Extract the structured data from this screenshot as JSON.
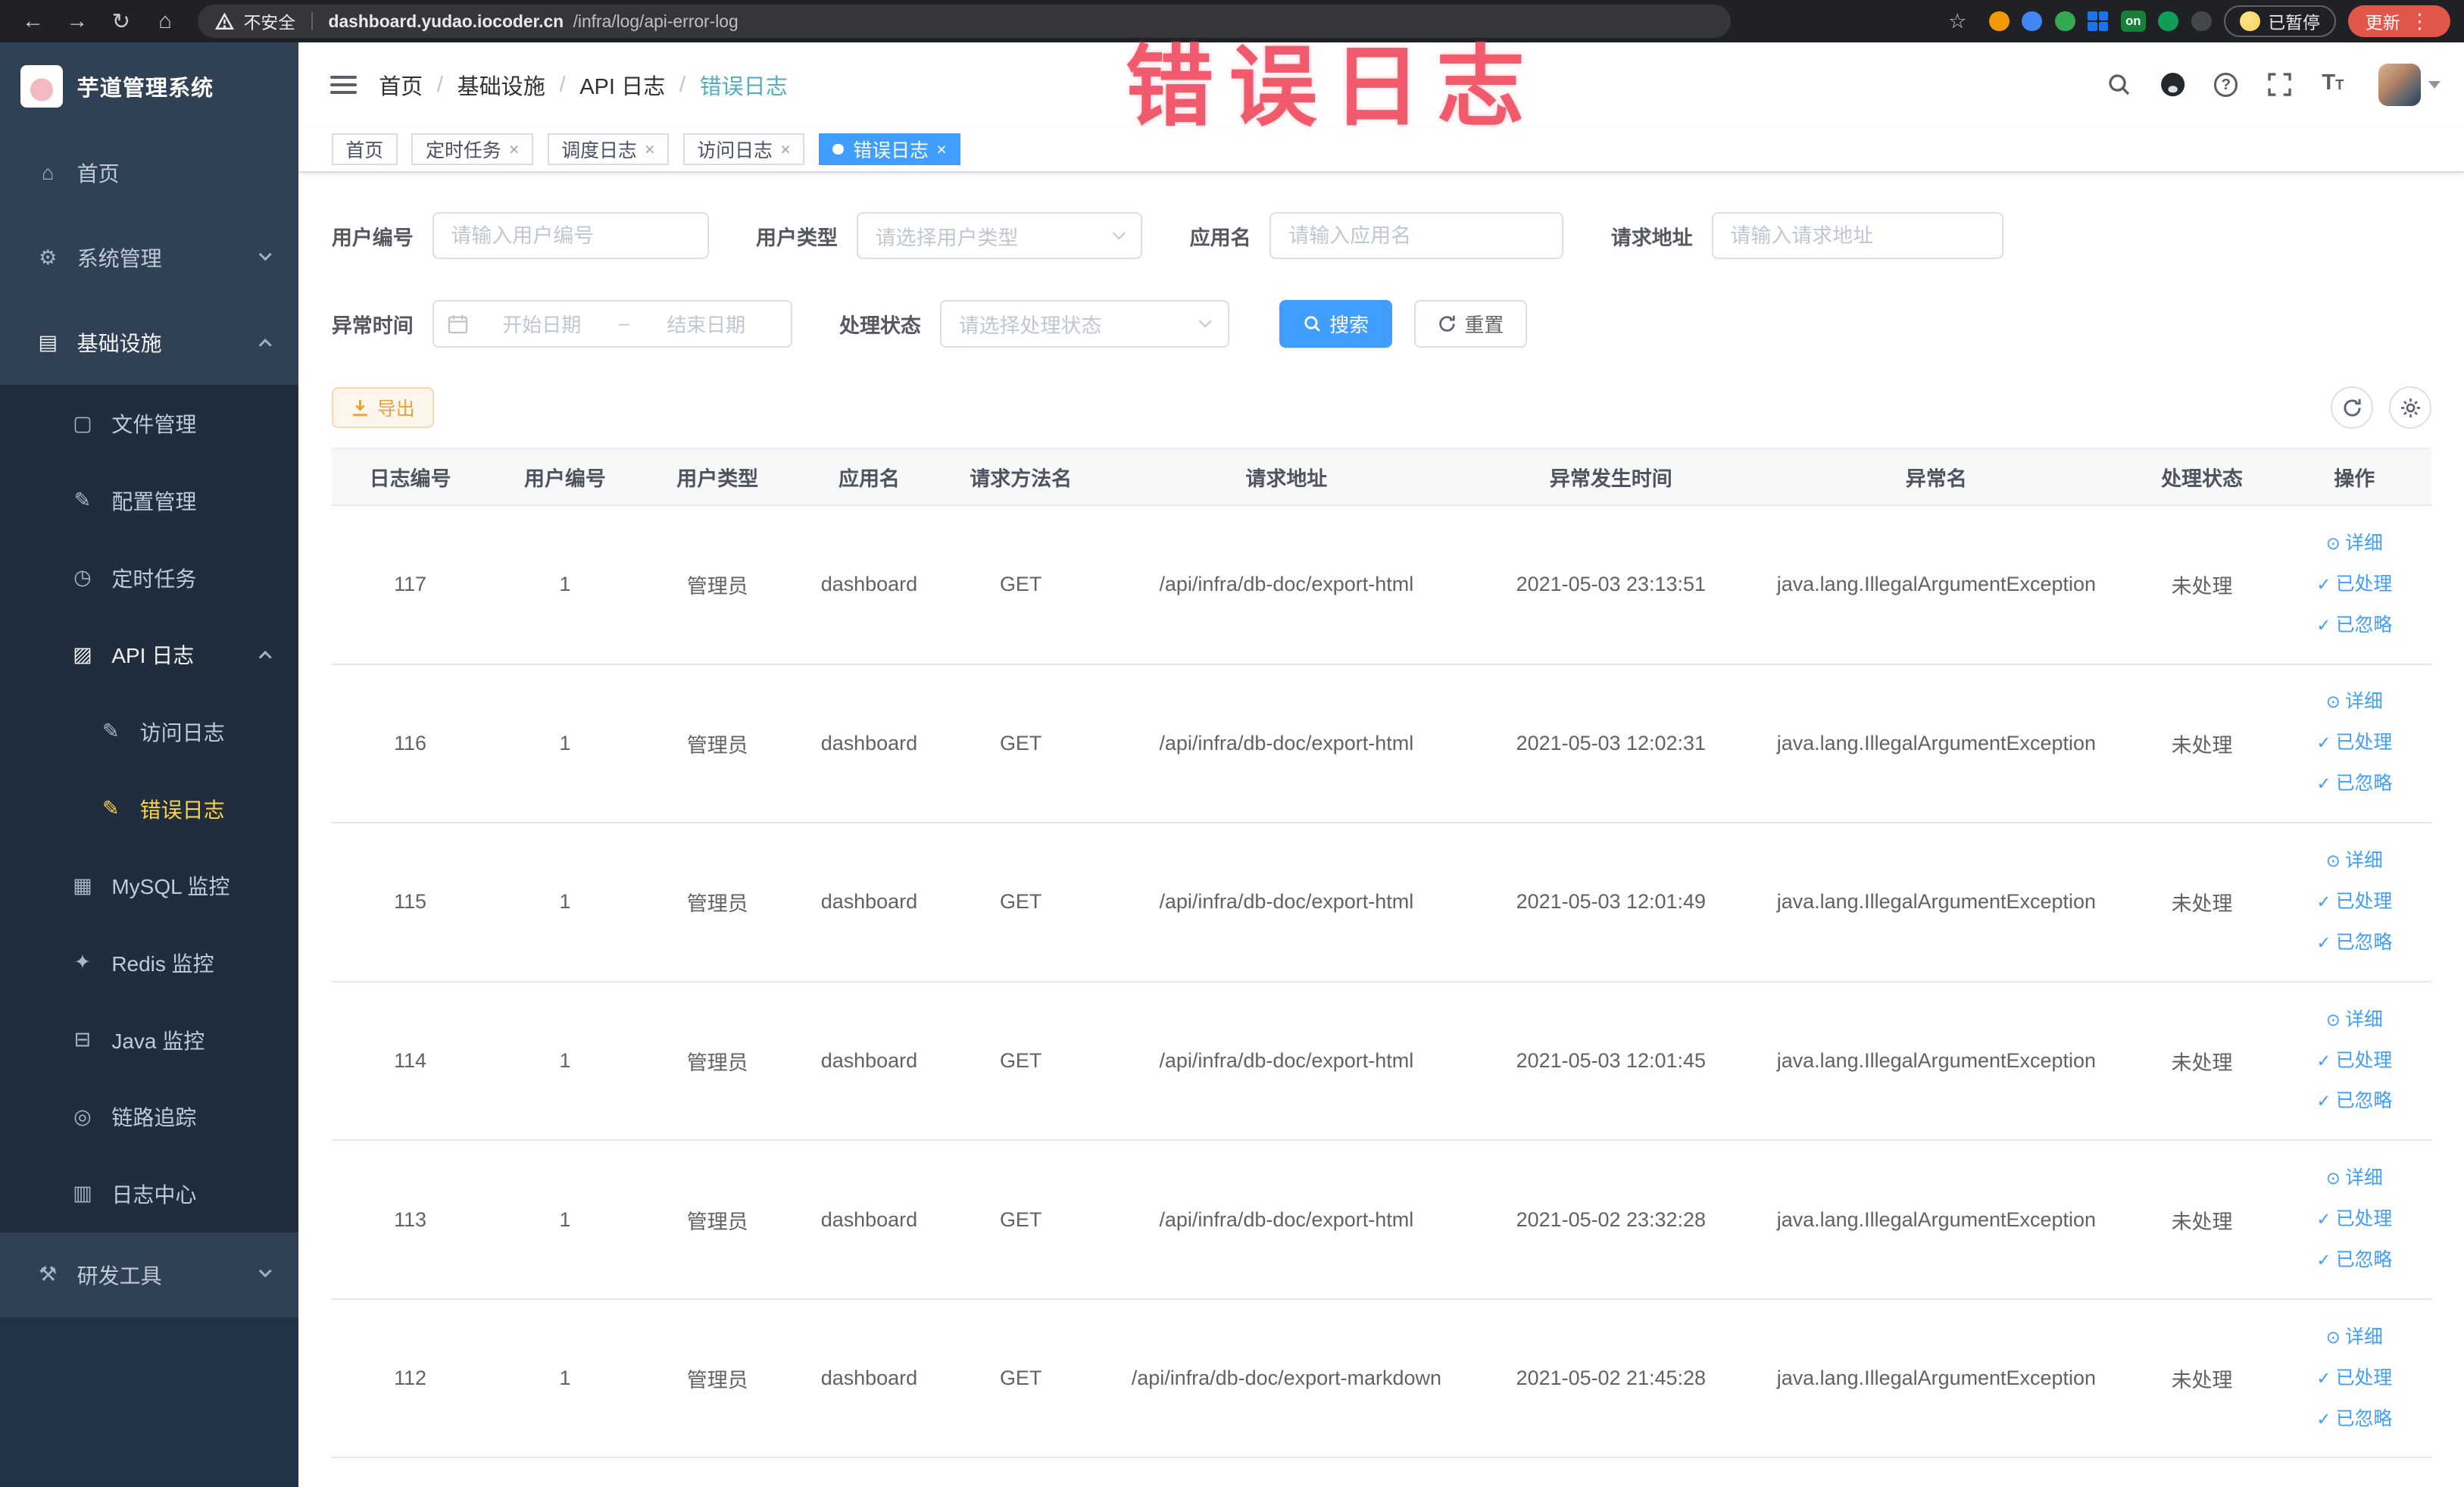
{
  "colors": {
    "accent": "#409eff",
    "menu_active": "#ffd04b",
    "warning": "#e6a23c",
    "watermark_red": "#ee4458",
    "sidebar_bg": "#304156",
    "submenu_bg": "#1f2d3d"
  },
  "browser": {
    "security_label": "不安全",
    "url_host": "dashboard.yudao.iocoder.cn",
    "url_path": "/infra/log/api-error-log",
    "extension_on_badge": "on",
    "paused_badge": "已暂停",
    "update_button": "更新"
  },
  "watermark": "错误日志",
  "sidebar": {
    "logo_title": "芋道管理系统",
    "items": {
      "home": "首页",
      "system": "系统管理",
      "infra": "基础设施",
      "file": "文件管理",
      "config": "配置管理",
      "job": "定时任务",
      "apilog": "API 日志",
      "accesslog": "访问日志",
      "errorlog": "错误日志",
      "mysql": "MySQL 监控",
      "redis": "Redis 监控",
      "java": "Java 监控",
      "trace": "链路追踪",
      "logcenter": "日志中心",
      "devtools": "研发工具"
    }
  },
  "breadcrumb": {
    "home": "首页",
    "infra": "基础设施",
    "apilog": "API 日志",
    "current": "错误日志",
    "separator": "/"
  },
  "tabs": {
    "home": "首页",
    "job": "定时任务",
    "job_log": "调度日志",
    "access_log": "访问日志",
    "error_log": "错误日志"
  },
  "filters": {
    "user_id_label": "用户编号",
    "user_id_placeholder": "请输入用户编号",
    "user_type_label": "用户类型",
    "user_type_placeholder": "请选择用户类型",
    "app_name_label": "应用名",
    "app_name_placeholder": "请输入应用名",
    "request_url_label": "请求地址",
    "request_url_placeholder": "请输入请求地址",
    "exception_time_label": "异常时间",
    "start_date_placeholder": "开始日期",
    "range_separator": "–",
    "end_date_placeholder": "结束日期",
    "process_status_label": "处理状态",
    "process_status_placeholder": "请选择处理状态",
    "search_button": "搜索",
    "reset_button": "重置"
  },
  "toolbar": {
    "export_button": "导出"
  },
  "table": {
    "columns": [
      "日志编号",
      "用户编号",
      "用户类型",
      "应用名",
      "请求方法名",
      "请求地址",
      "异常发生时间",
      "异常名",
      "处理状态",
      "操作"
    ],
    "actions": [
      "详细",
      "已处理",
      "已忽略"
    ],
    "rows": [
      {
        "id": "117",
        "user_id": "1",
        "user_type": "管理员",
        "app": "dashboard",
        "method": "GET",
        "url": "/api/infra/db-doc/export-html",
        "time": "2021-05-03 23:13:51",
        "exception": "java.lang.IllegalArgumentException",
        "status": "未处理"
      },
      {
        "id": "116",
        "user_id": "1",
        "user_type": "管理员",
        "app": "dashboard",
        "method": "GET",
        "url": "/api/infra/db-doc/export-html",
        "time": "2021-05-03 12:02:31",
        "exception": "java.lang.IllegalArgumentException",
        "status": "未处理"
      },
      {
        "id": "115",
        "user_id": "1",
        "user_type": "管理员",
        "app": "dashboard",
        "method": "GET",
        "url": "/api/infra/db-doc/export-html",
        "time": "2021-05-03 12:01:49",
        "exception": "java.lang.IllegalArgumentException",
        "status": "未处理"
      },
      {
        "id": "114",
        "user_id": "1",
        "user_type": "管理员",
        "app": "dashboard",
        "method": "GET",
        "url": "/api/infra/db-doc/export-html",
        "time": "2021-05-03 12:01:45",
        "exception": "java.lang.IllegalArgumentException",
        "status": "未处理"
      },
      {
        "id": "113",
        "user_id": "1",
        "user_type": "管理员",
        "app": "dashboard",
        "method": "GET",
        "url": "/api/infra/db-doc/export-html",
        "time": "2021-05-02 23:32:28",
        "exception": "java.lang.IllegalArgumentException",
        "status": "未处理"
      },
      {
        "id": "112",
        "user_id": "1",
        "user_type": "管理员",
        "app": "dashboard",
        "method": "GET",
        "url": "/api/infra/db-doc/export-markdown",
        "time": "2021-05-02 21:45:28",
        "exception": "java.lang.IllegalArgumentException",
        "status": "未处理"
      }
    ]
  }
}
